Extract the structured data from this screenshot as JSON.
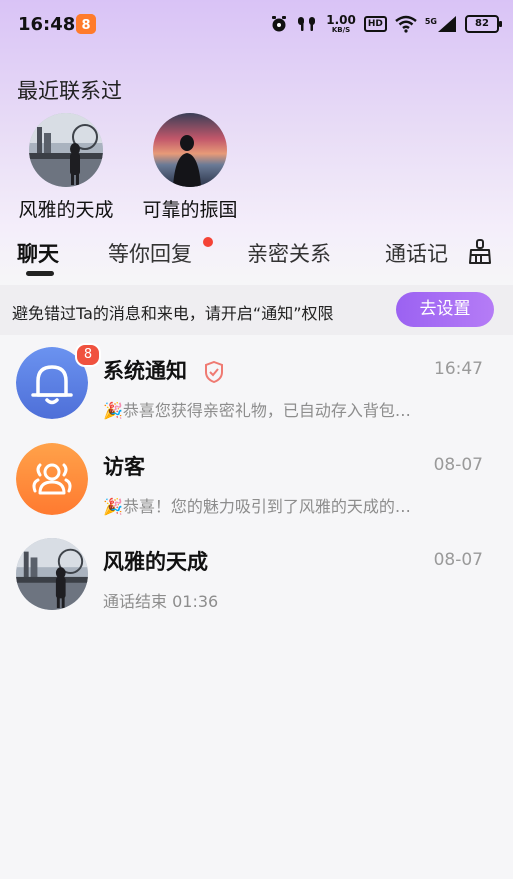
{
  "status_bar": {
    "time": "16:48",
    "app_badge": "8",
    "net_speed_value": "1.00",
    "net_speed_unit": "KB/S",
    "hd": "HD",
    "signal_type": "5G",
    "battery": "82",
    "icons": [
      "alarm-icon",
      "earbuds-icon",
      "wifi-icon",
      "signal-icon"
    ]
  },
  "recent": {
    "title": "最近联系过",
    "contacts": [
      {
        "name": "风雅的天成",
        "avatar": "avatar-photo-city"
      },
      {
        "name": "可靠的振国",
        "avatar": "avatar-photo-sunset"
      }
    ]
  },
  "tabs": [
    {
      "label": "聊天",
      "active": true
    },
    {
      "label": "等你回复",
      "has_dot": true
    },
    {
      "label": "亲密关系"
    },
    {
      "label": "通话记"
    }
  ],
  "clear_icon": "broom-icon",
  "notice": {
    "text": "避免错过Ta的消息和来电，请开启“通知”权限",
    "button": "去设置"
  },
  "chats": [
    {
      "name": "系统通知",
      "time": "16:47",
      "preview": "🎉恭喜您获得亲密礼物，已自动存入背包…",
      "unread": "8",
      "verified_icon": "shield-check-icon",
      "avatar_icon": "bell-icon"
    },
    {
      "name": "访客",
      "time": "08-07",
      "preview": "🎉恭喜！您的魅力吸引到了风雅的天成的…",
      "avatar_icon": "users-icon"
    },
    {
      "name": "风雅的天成",
      "time": "08-07",
      "preview": "通话结束 01:36",
      "avatar_icon": "avatar-photo-city"
    }
  ],
  "colors": {
    "accent": "#9b62f2",
    "badge": "#f0523f",
    "bell_bg": "#5b82e6",
    "visitor_bg": "#ff8a3c"
  }
}
